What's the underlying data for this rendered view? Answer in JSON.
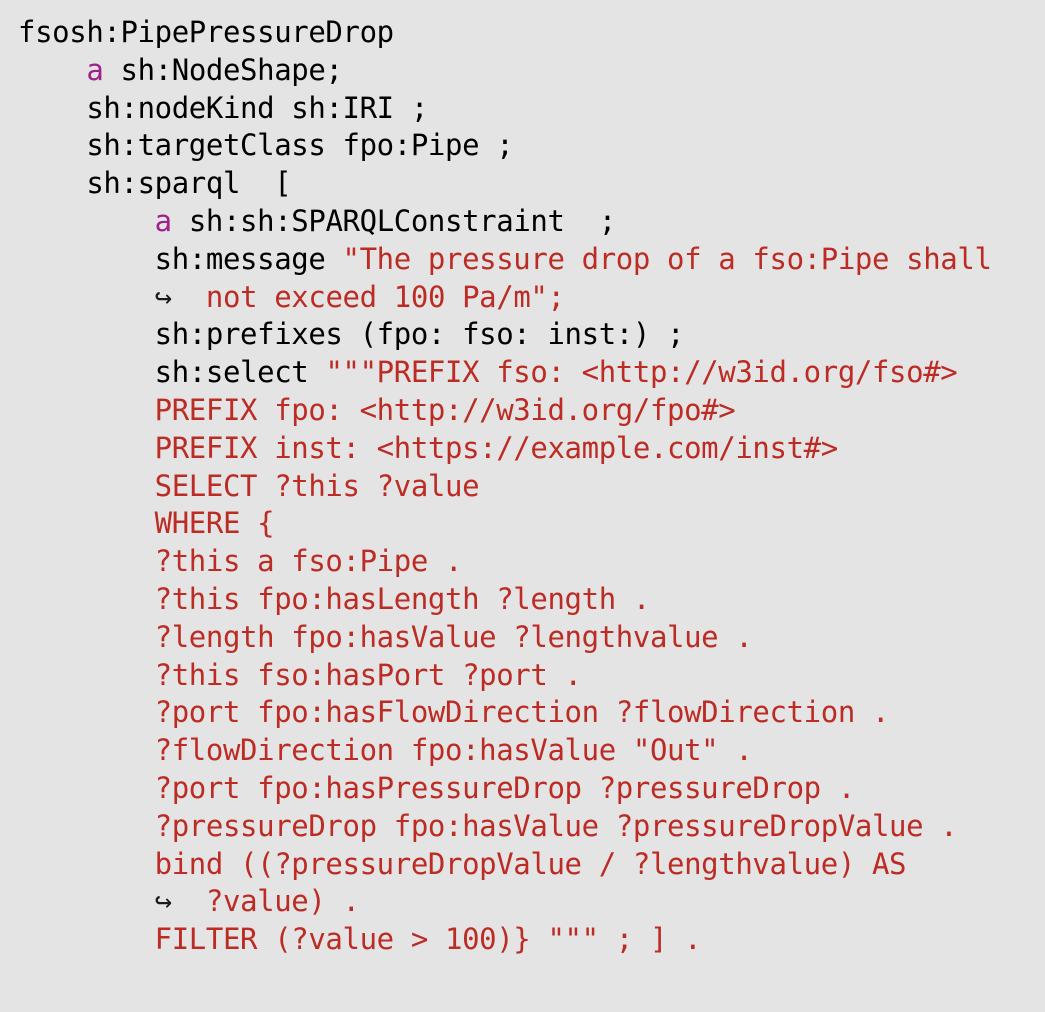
{
  "listing": {
    "language": "turtle-shacl",
    "background_color": "#e4e4e4",
    "colors": {
      "plain": "#000000",
      "keyword": "#a0208c",
      "string": "#bc2b24"
    },
    "continuation_marker": "↪",
    "lines": [
      {
        "indent": 0,
        "tokens": [
          {
            "style": "plain",
            "text": "fsosh:PipePressureDrop"
          }
        ]
      },
      {
        "indent": 4,
        "tokens": [
          {
            "style": "keyword",
            "text": "a"
          },
          {
            "style": "plain",
            "text": " sh:NodeShape;"
          }
        ]
      },
      {
        "indent": 4,
        "tokens": [
          {
            "style": "plain",
            "text": "sh:nodeKind sh:IRI ;"
          }
        ]
      },
      {
        "indent": 4,
        "tokens": [
          {
            "style": "plain",
            "text": "sh:targetClass fpo:Pipe ;"
          }
        ]
      },
      {
        "indent": 4,
        "tokens": [
          {
            "style": "plain",
            "text": "sh:sparql  ["
          }
        ]
      },
      {
        "indent": 8,
        "tokens": [
          {
            "style": "keyword",
            "text": "a"
          },
          {
            "style": "plain",
            "text": " sh:sh:SPARQLConstraint  ;"
          }
        ]
      },
      {
        "indent": 8,
        "tokens": [
          {
            "style": "plain",
            "text": "sh:message "
          },
          {
            "style": "string",
            "text": "\"The pressure drop of a fso:Pipe shall"
          }
        ]
      },
      {
        "indent": 8,
        "continuation": true,
        "tokens": [
          {
            "style": "string",
            "text": "not exceed 100 Pa/m\";"
          }
        ]
      },
      {
        "indent": 8,
        "tokens": [
          {
            "style": "plain",
            "text": "sh:prefixes (fpo: fso: inst:) ;"
          }
        ]
      },
      {
        "indent": 8,
        "tokens": [
          {
            "style": "plain",
            "text": "sh:select "
          },
          {
            "style": "string",
            "text": "\"\"\"PREFIX fso: <http://w3id.org/fso#>"
          }
        ]
      },
      {
        "indent": 8,
        "tokens": [
          {
            "style": "string",
            "text": "PREFIX fpo: <http://w3id.org/fpo#>"
          }
        ]
      },
      {
        "indent": 8,
        "tokens": [
          {
            "style": "string",
            "text": "PREFIX inst: <https://example.com/inst#>"
          }
        ]
      },
      {
        "indent": 8,
        "tokens": [
          {
            "style": "string",
            "text": "SELECT ?this ?value"
          }
        ]
      },
      {
        "indent": 8,
        "tokens": [
          {
            "style": "string",
            "text": "WHERE {"
          }
        ]
      },
      {
        "indent": 8,
        "tokens": [
          {
            "style": "string",
            "text": "?this a fso:Pipe ."
          }
        ]
      },
      {
        "indent": 8,
        "tokens": [
          {
            "style": "string",
            "text": "?this fpo:hasLength ?length ."
          }
        ]
      },
      {
        "indent": 8,
        "tokens": [
          {
            "style": "string",
            "text": "?length fpo:hasValue ?lengthvalue ."
          }
        ]
      },
      {
        "indent": 8,
        "tokens": [
          {
            "style": "string",
            "text": "?this fso:hasPort ?port ."
          }
        ]
      },
      {
        "indent": 8,
        "tokens": [
          {
            "style": "string",
            "text": "?port fpo:hasFlowDirection ?flowDirection ."
          }
        ]
      },
      {
        "indent": 8,
        "tokens": [
          {
            "style": "string",
            "text": "?flowDirection fpo:hasValue \"Out\" ."
          }
        ]
      },
      {
        "indent": 8,
        "tokens": [
          {
            "style": "string",
            "text": "?port fpo:hasPressureDrop ?pressureDrop ."
          }
        ]
      },
      {
        "indent": 8,
        "tokens": [
          {
            "style": "string",
            "text": "?pressureDrop fpo:hasValue ?pressureDropValue ."
          }
        ]
      },
      {
        "indent": 8,
        "tokens": [
          {
            "style": "string",
            "text": "bind ((?pressureDropValue / ?lengthvalue) AS"
          }
        ]
      },
      {
        "indent": 8,
        "continuation": true,
        "tokens": [
          {
            "style": "string",
            "text": "?value) ."
          }
        ]
      },
      {
        "indent": 8,
        "tokens": [
          {
            "style": "string",
            "text": "FILTER (?value > 100)} \"\"\" ; ] ."
          }
        ]
      }
    ]
  }
}
